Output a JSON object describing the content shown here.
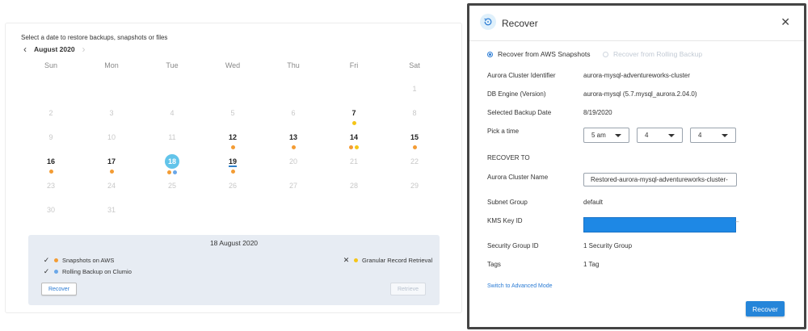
{
  "calendar": {
    "instruction": "Select a date to restore backups, snapshots or files",
    "month": "August 2020",
    "prev_icon": "chevron-left-icon",
    "next_icon": "chevron-right-icon",
    "weekdays": [
      "Sun",
      "Mon",
      "Tue",
      "Wed",
      "Thu",
      "Fri",
      "Sat"
    ],
    "weeks": [
      [
        {
          "n": ""
        },
        {
          "n": ""
        },
        {
          "n": ""
        },
        {
          "n": ""
        },
        {
          "n": ""
        },
        {
          "n": ""
        },
        {
          "n": "1"
        }
      ],
      [
        {
          "n": "2"
        },
        {
          "n": "3"
        },
        {
          "n": "4"
        },
        {
          "n": "5"
        },
        {
          "n": "6"
        },
        {
          "n": "7",
          "active": true,
          "dots": [
            "yellow"
          ]
        },
        {
          "n": "8"
        }
      ],
      [
        {
          "n": "9"
        },
        {
          "n": "10"
        },
        {
          "n": "11"
        },
        {
          "n": "12",
          "active": true,
          "dots": [
            "orange"
          ]
        },
        {
          "n": "13",
          "active": true,
          "dots": [
            "orange"
          ]
        },
        {
          "n": "14",
          "active": true,
          "dots": [
            "orange",
            "yellow"
          ]
        },
        {
          "n": "15",
          "active": true,
          "dots": [
            "orange"
          ]
        }
      ],
      [
        {
          "n": "16",
          "active": true,
          "dots": [
            "orange"
          ]
        },
        {
          "n": "17",
          "active": true,
          "dots": [
            "orange"
          ]
        },
        {
          "n": "18",
          "active": true,
          "selected": true,
          "dots": [
            "orange",
            "blue"
          ]
        },
        {
          "n": "19",
          "active": true,
          "today": true,
          "dots": [
            "orange"
          ]
        },
        {
          "n": "20"
        },
        {
          "n": "21"
        },
        {
          "n": "22"
        }
      ],
      [
        {
          "n": "23"
        },
        {
          "n": "24"
        },
        {
          "n": "25"
        },
        {
          "n": "26"
        },
        {
          "n": "27"
        },
        {
          "n": "28"
        },
        {
          "n": "29"
        }
      ],
      [
        {
          "n": "30"
        },
        {
          "n": "31"
        },
        {
          "n": ""
        },
        {
          "n": ""
        },
        {
          "n": ""
        },
        {
          "n": ""
        },
        {
          "n": ""
        }
      ]
    ],
    "dot_colors": {
      "orange": "#f39c34",
      "yellow": "#f5c518",
      "blue": "#6aa7e8"
    },
    "selected_color": "#62c4ea"
  },
  "summary": {
    "date": "18 August 2020",
    "items": [
      {
        "mark": "✓",
        "dot": "orange",
        "label": "Snapshots on AWS"
      },
      {
        "mark": "✓",
        "dot": "blue",
        "label": "Rolling Backup on Clumio"
      },
      {
        "mark": "✕",
        "dot": "yellow",
        "label": "Granular Record Retrieval"
      }
    ],
    "recover_label": "Recover",
    "retrieve_label": "Retrieve"
  },
  "dialog": {
    "title": "Recover",
    "icon": "restore-icon",
    "close_icon": "close-icon",
    "options": {
      "snapshots": "Recover from AWS Snapshots",
      "rolling": "Recover from Rolling Backup"
    },
    "fields": {
      "cluster_id_label": "Aurora Cluster Identifier",
      "cluster_id_value": "aurora-mysql-adventureworks-cluster",
      "engine_label": "DB Engine (Version)",
      "engine_value": "aurora-mysql (5.7.mysql_aurora.2.04.0)",
      "backup_date_label": "Selected Backup Date",
      "backup_date_value": "8/19/2020",
      "pick_time_label": "Pick a time",
      "hour": "5 am",
      "minute": "4",
      "second": "4",
      "recover_to_label": "RECOVER TO",
      "cluster_name_label": "Aurora Cluster Name",
      "cluster_name_value": "Restored-aurora-mysql-adventureworks-cluster-",
      "subnet_label": "Subnet Group",
      "subnet_value": "default",
      "kms_label": "KMS Key ID",
      "sg_label": "Security Group ID",
      "sg_value": "1 Security Group",
      "tags_label": "Tags",
      "tags_value": "1 Tag"
    },
    "advanced_link": "Switch to Advanced Mode",
    "recover_button": "Recover",
    "accent_color": "#2585d9"
  }
}
